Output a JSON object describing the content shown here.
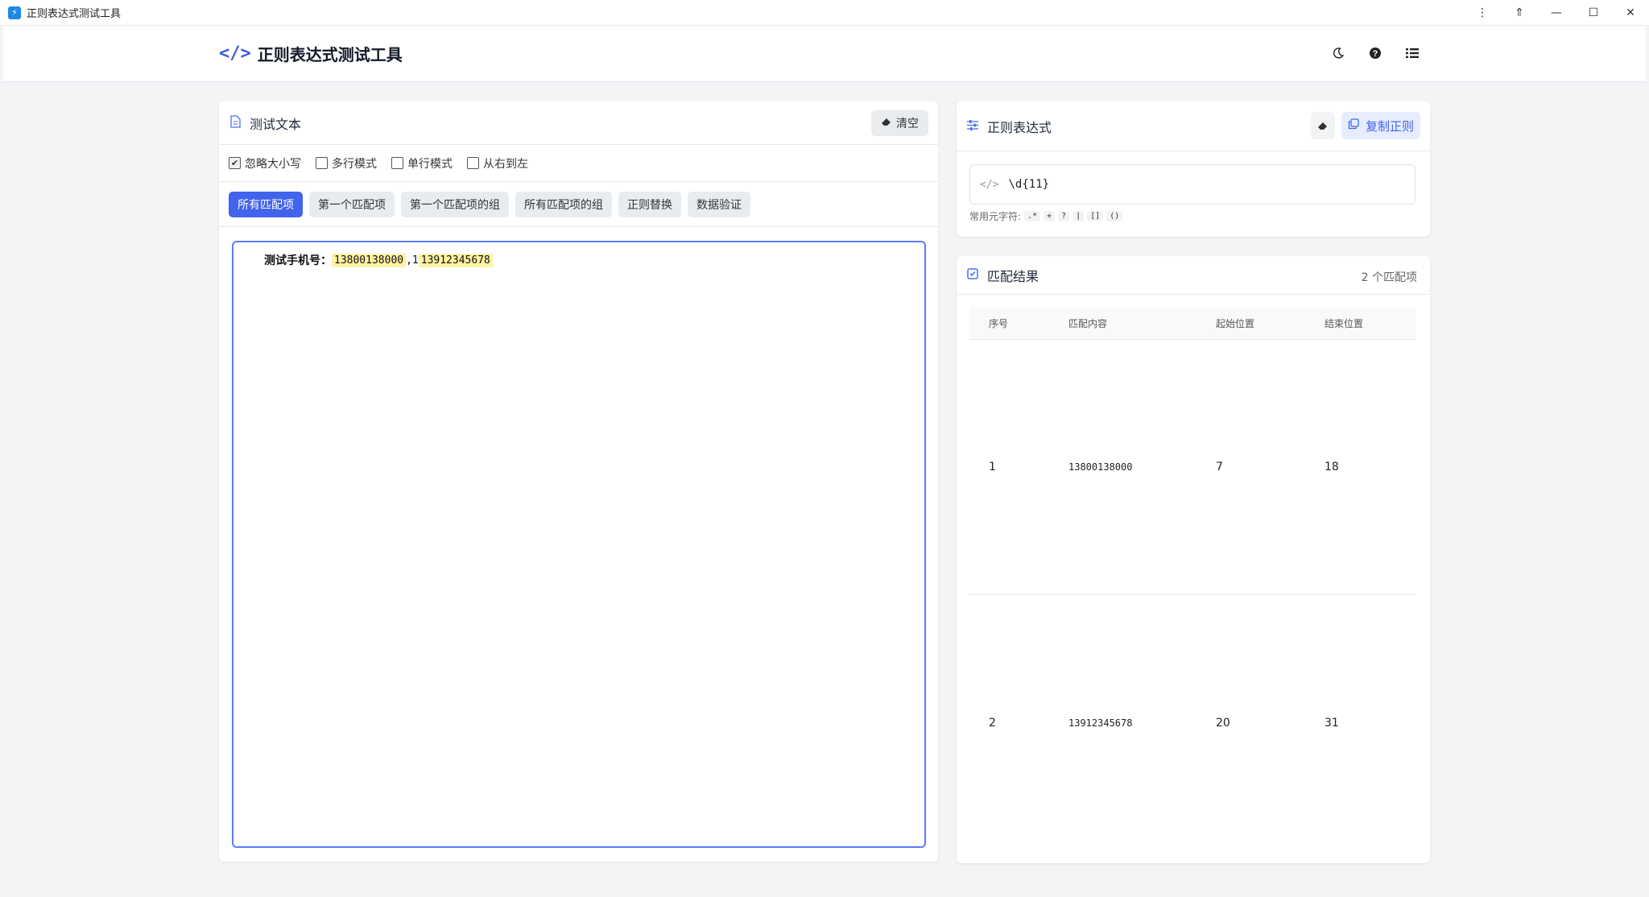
{
  "window": {
    "title": "正则表达式测试工具",
    "controls": [
      "⋮",
      "⇑",
      "—",
      "☐",
      "✕"
    ]
  },
  "header": {
    "title": "正则表达式测试工具",
    "icons": [
      "moon-icon",
      "help-icon",
      "list-icon"
    ]
  },
  "test_text": {
    "title": "测试文本",
    "clear_label": "清空",
    "options": [
      {
        "label": "忽略大小写",
        "checked": true
      },
      {
        "label": "多行模式",
        "checked": false
      },
      {
        "label": "单行模式",
        "checked": false
      },
      {
        "label": "从右到左",
        "checked": false
      }
    ],
    "tabs": [
      {
        "label": "所有匹配项",
        "active": true
      },
      {
        "label": "第一个匹配项",
        "active": false
      },
      {
        "label": "第一个匹配项的组",
        "active": false
      },
      {
        "label": "所有匹配项的组",
        "active": false
      },
      {
        "label": "正则替换",
        "active": false
      },
      {
        "label": "数据验证",
        "active": false
      }
    ],
    "content": {
      "prefix": "测试手机号：",
      "match1": "13800138000",
      "separator": ",1",
      "match2": "13912345678"
    }
  },
  "regex": {
    "title": "正则表达式",
    "copy_label": "复制正则",
    "value": "\\d{11}",
    "meta_label": "常用元字符:",
    "meta_chars": [
      ".*",
      "+",
      "?",
      "|",
      "[]",
      "()"
    ]
  },
  "results": {
    "title": "匹配结果",
    "count": "2 个匹配项",
    "columns": [
      "序号",
      "匹配内容",
      "起始位置",
      "结束位置"
    ],
    "rows": [
      {
        "index": "1",
        "content": "13800138000",
        "start": "7",
        "end": "18"
      },
      {
        "index": "2",
        "content": "13912345678",
        "start": "20",
        "end": "31"
      }
    ]
  },
  "colors": {
    "accent": "#4263eb",
    "highlight": "#fff3a3",
    "background": "#f3f4f6"
  }
}
